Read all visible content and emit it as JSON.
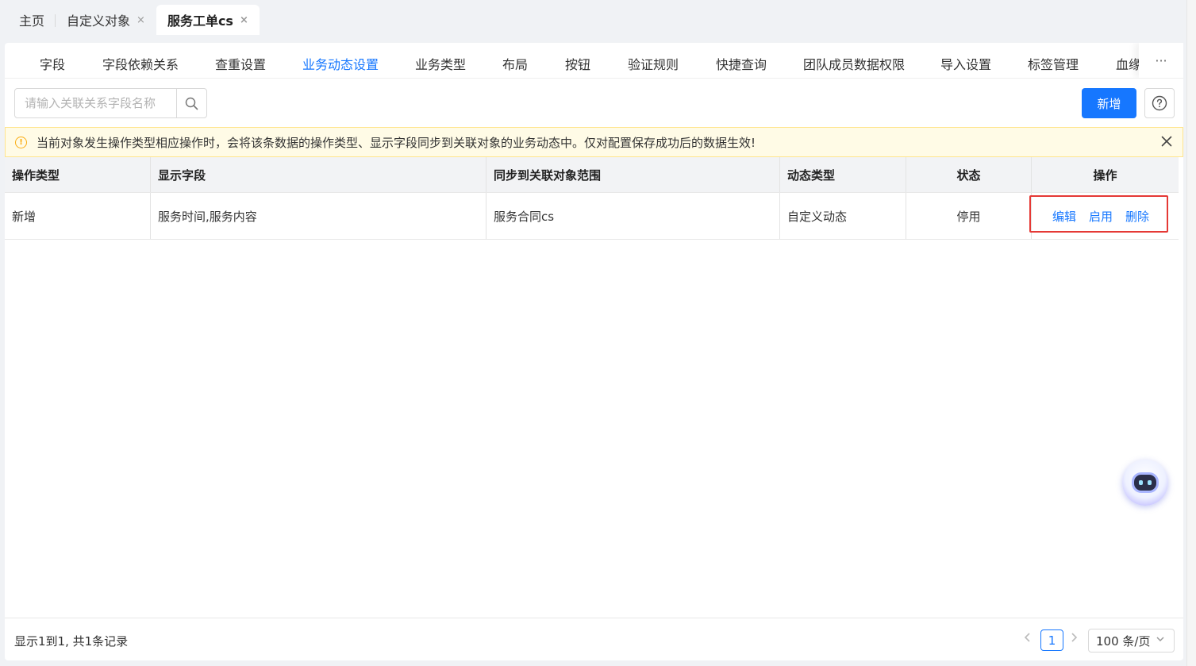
{
  "top_tabs": [
    {
      "label": "主页",
      "closable": false,
      "active": false
    },
    {
      "label": "自定义对象",
      "closable": true,
      "active": false
    },
    {
      "label": "服务工单cs",
      "closable": true,
      "active": true
    }
  ],
  "close_glyph": "×",
  "sub_tabs": [
    "字段",
    "字段依赖关系",
    "查重设置",
    "业务动态设置",
    "业务类型",
    "布局",
    "按钮",
    "验证规则",
    "快捷查询",
    "团队成员数据权限",
    "导入设置",
    "标签管理",
    "血缘"
  ],
  "active_sub_tab": "业务动态设置",
  "more_glyph": "···",
  "search": {
    "placeholder": "请输入关联关系字段名称",
    "value": ""
  },
  "toolbar": {
    "add_label": "新增"
  },
  "alert": {
    "text": "当前对象发生操作类型相应操作时，会将该条数据的操作类型、显示字段同步到关联对象的业务动态中。仅对配置保存成功后的数据生效!",
    "color": "#faad14"
  },
  "table": {
    "columns": [
      "操作类型",
      "显示字段",
      "同步到关联对象范围",
      "动态类型",
      "状态",
      "操作"
    ],
    "rows": [
      {
        "op_type": "新增",
        "display_fields": "服务时间,服务内容",
        "sync_scope": "服务合同cs",
        "dynamic_type": "自定义动态",
        "status": "停用",
        "actions": [
          "编辑",
          "启用",
          "删除"
        ]
      }
    ]
  },
  "footer": {
    "summary": "显示1到1, 共1条记录",
    "current_page": "1",
    "page_size": "100 条/页"
  },
  "colors": {
    "primary": "#1677ff",
    "highlight_box": "#e53935"
  }
}
